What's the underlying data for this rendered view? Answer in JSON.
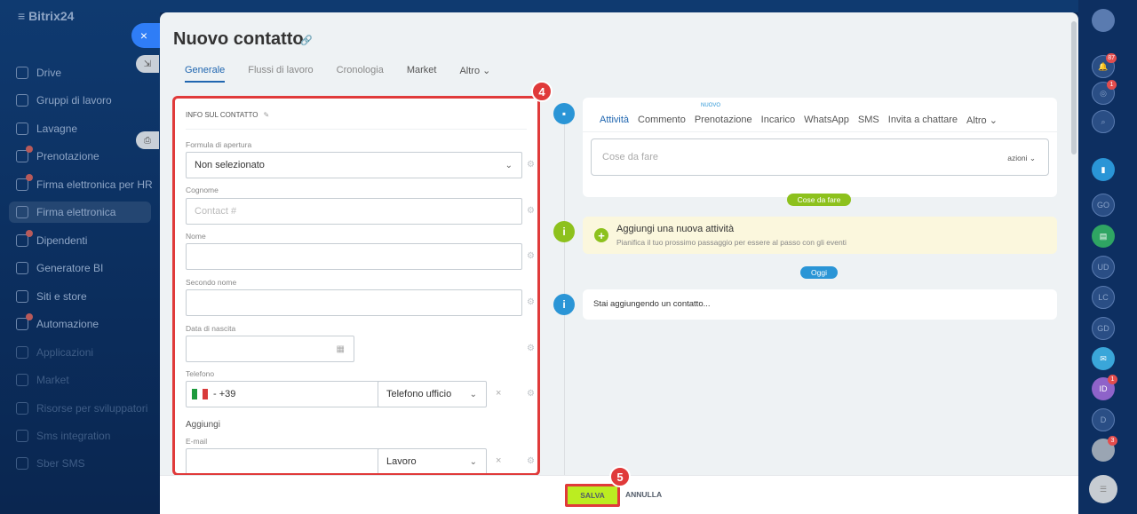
{
  "app": {
    "name": "Bitrix24",
    "close_symbol": "×"
  },
  "sidebar": {
    "items": [
      {
        "label": "Drive",
        "state": "normal",
        "badge": false
      },
      {
        "label": "Gruppi di lavoro",
        "state": "normal",
        "badge": false
      },
      {
        "label": "Lavagne",
        "state": "normal",
        "badge": false
      },
      {
        "label": "Prenotazione",
        "state": "normal",
        "badge": true
      },
      {
        "label": "Firma elettronica per HR",
        "state": "normal",
        "badge": true
      },
      {
        "label": "Firma elettronica",
        "state": "active",
        "badge": false
      },
      {
        "label": "Dipendenti",
        "state": "normal",
        "badge": true
      },
      {
        "label": "Generatore BI",
        "state": "normal",
        "badge": false
      },
      {
        "label": "Siti e store",
        "state": "normal",
        "badge": false
      },
      {
        "label": "Automazione",
        "state": "normal",
        "badge": true
      },
      {
        "label": "Applicazioni",
        "state": "faded",
        "badge": false
      },
      {
        "label": "Market",
        "state": "faded",
        "badge": false
      },
      {
        "label": "Risorse per sviluppatori",
        "state": "faded",
        "badge": false
      },
      {
        "label": "Sms integration",
        "state": "faded",
        "badge": false
      },
      {
        "label": "Sber SMS",
        "state": "faded",
        "badge": false
      }
    ]
  },
  "header": {
    "title": "Nuovo contatto",
    "tabs": [
      {
        "label": "Generale",
        "active": true
      },
      {
        "label": "Flussi di lavoro",
        "active": false
      },
      {
        "label": "Cronologia",
        "active": false
      },
      {
        "label": "Market",
        "active": false
      },
      {
        "label": "Altro ⌄",
        "active": false
      }
    ]
  },
  "contact_form": {
    "section_title": "INFO SUL CONTATTO",
    "fields": {
      "salutation": {
        "label": "Formula di apertura",
        "value": "Non selezionato"
      },
      "last_name": {
        "label": "Cognome",
        "placeholder": "Contact #",
        "value": ""
      },
      "first_name": {
        "label": "Nome",
        "value": ""
      },
      "middle_name": {
        "label": "Secondo nome",
        "value": ""
      },
      "birthdate": {
        "label": "Data di nascita",
        "value": ""
      },
      "phone": {
        "label": "Telefono",
        "value": "- +39",
        "type_value": "Telefono ufficio"
      },
      "add_label": "Aggiungi",
      "email": {
        "label": "E-mail",
        "value": "",
        "type_value": "Lavoro"
      }
    }
  },
  "timeline": {
    "activity_tabs": [
      "Attività",
      "Commento",
      "Prenotazione",
      "Incarico",
      "WhatsApp",
      "SMS",
      "Invita a chattare",
      "Altro ⌄"
    ],
    "new_badge": "NUOVO",
    "todo_placeholder": "Cose da fare",
    "todo_actions": "azioni ⌄",
    "pill_todo": "Cose da fare",
    "add_activity_title": "Aggiungi una nuova attività",
    "add_activity_sub": "Pianifica il tuo prossimo passaggio per essere al passo con gli eventi",
    "pill_today": "Oggi",
    "adding_note": "Stai aggiungendo un contatto..."
  },
  "footer": {
    "save_label": "SALVA",
    "cancel_label": "ANNULLA"
  },
  "annotations": {
    "step_form": "4",
    "step_save": "5"
  },
  "right_rail": {
    "badges": {
      "notifications": "87",
      "activity": "1",
      "user_id": "1",
      "last": "3"
    },
    "avatars": [
      "GO",
      "UD",
      "LC",
      "GD",
      "ID",
      "D"
    ]
  },
  "colors": {
    "accent": "#2066b0",
    "highlight": "#e03a3a",
    "save_button": "#bbed21",
    "timeline_green": "#8dc11d",
    "timeline_blue": "#2a95d6"
  }
}
